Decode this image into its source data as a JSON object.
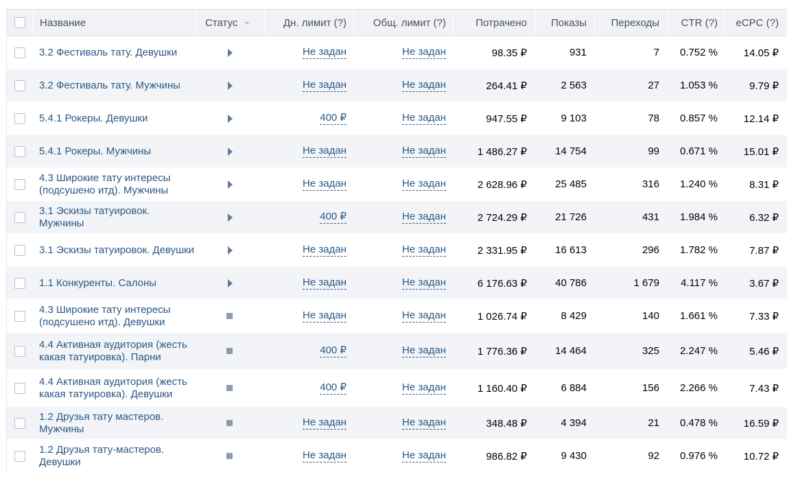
{
  "header": {
    "name": "Название",
    "status": "Статус",
    "daily_limit": "Дн. лимит (?)",
    "total_limit": "Общ. лимит (?)",
    "spent": "Потрачено",
    "impressions": "Показы",
    "clicks": "Переходы",
    "ctr": "CTR (?)",
    "ecpc": "eCPC (?)"
  },
  "rows": [
    {
      "name": "3.2 Фестиваль тату. Девушки",
      "status": "play",
      "daily": "Не задан",
      "total": "Не задан",
      "spent": "98.35 ₽",
      "shows": "931",
      "clicks": "7",
      "ctr": "0.752 %",
      "ecpc": "14.05 ₽"
    },
    {
      "name": "3.2 Фестиваль тату. Мужчины",
      "status": "play",
      "daily": "Не задан",
      "total": "Не задан",
      "spent": "264.41 ₽",
      "shows": "2 563",
      "clicks": "27",
      "ctr": "1.053 %",
      "ecpc": "9.79 ₽"
    },
    {
      "name": "5.4.1 Рокеры. Девушки",
      "status": "play",
      "daily": "400 ₽",
      "total": "Не задан",
      "spent": "947.55 ₽",
      "shows": "9 103",
      "clicks": "78",
      "ctr": "0.857 %",
      "ecpc": "12.14 ₽"
    },
    {
      "name": "5.4.1 Рокеры. Мужчины",
      "status": "play",
      "daily": "Не задан",
      "total": "Не задан",
      "spent": "1 486.27 ₽",
      "shows": "14 754",
      "clicks": "99",
      "ctr": "0.671 %",
      "ecpc": "15.01 ₽"
    },
    {
      "name": "4.3 Широкие тату интересы (подсушено итд). Мужчины",
      "status": "play",
      "daily": "Не задан",
      "total": "Не задан",
      "spent": "2 628.96 ₽",
      "shows": "25 485",
      "clicks": "316",
      "ctr": "1.240 %",
      "ecpc": "8.31 ₽"
    },
    {
      "name": "3.1 Эскизы татуировок. Мужчины",
      "status": "play",
      "daily": "400 ₽",
      "total": "Не задан",
      "spent": "2 724.29 ₽",
      "shows": "21 726",
      "clicks": "431",
      "ctr": "1.984 %",
      "ecpc": "6.32 ₽"
    },
    {
      "name": "3.1 Эскизы татуировок. Девушки",
      "status": "play",
      "daily": "Не задан",
      "total": "Не задан",
      "spent": "2 331.95 ₽",
      "shows": "16 613",
      "clicks": "296",
      "ctr": "1.782 %",
      "ecpc": "7.87 ₽"
    },
    {
      "name": "1.1 Конкуренты. Салоны",
      "status": "play",
      "daily": "Не задан",
      "total": "Не задан",
      "spent": "6 176.63 ₽",
      "shows": "40 786",
      "clicks": "1 679",
      "ctr": "4.117 %",
      "ecpc": "3.67 ₽"
    },
    {
      "name": "4.3 Широкие тату интересы (подсушено итд). Девушки",
      "status": "stop",
      "daily": "Не задан",
      "total": "Не задан",
      "spent": "1 026.74 ₽",
      "shows": "8 429",
      "clicks": "140",
      "ctr": "1.661 %",
      "ecpc": "7.33 ₽"
    },
    {
      "name": "4.4 Активная аудитория (жесть какая татуировка). Парни",
      "status": "stop",
      "daily": "400 ₽",
      "total": "Не задан",
      "spent": "1 776.36 ₽",
      "shows": "14 464",
      "clicks": "325",
      "ctr": "2.247 %",
      "ecpc": "5.46 ₽"
    },
    {
      "name": "4.4 Активная аудитория (жесть какая татуировка). Девушки",
      "status": "stop",
      "daily": "400 ₽",
      "total": "Не задан",
      "spent": "1 160.40 ₽",
      "shows": "6 884",
      "clicks": "156",
      "ctr": "2.266 %",
      "ecpc": "7.43 ₽"
    },
    {
      "name": "1.2 Друзья тату мастеров. Мужчины",
      "status": "stop",
      "daily": "Не задан",
      "total": "Не задан",
      "spent": "348.48 ₽",
      "shows": "4 394",
      "clicks": "21",
      "ctr": "0.478 %",
      "ecpc": "16.59 ₽"
    },
    {
      "name": "1.2 Друзья тату-мастеров. Девушки",
      "status": "stop",
      "daily": "Не задан",
      "total": "Не задан",
      "spent": "986.82 ₽",
      "shows": "9 430",
      "clicks": "92",
      "ctr": "0.976 %",
      "ecpc": "10.72 ₽"
    }
  ],
  "colors": {
    "link": "#2a5885",
    "header_bg": "#f0f2f5",
    "stripe_bg": "#f2f4f7",
    "play_icon": "#5f7aa3",
    "stop_icon": "#8d9bb0"
  }
}
